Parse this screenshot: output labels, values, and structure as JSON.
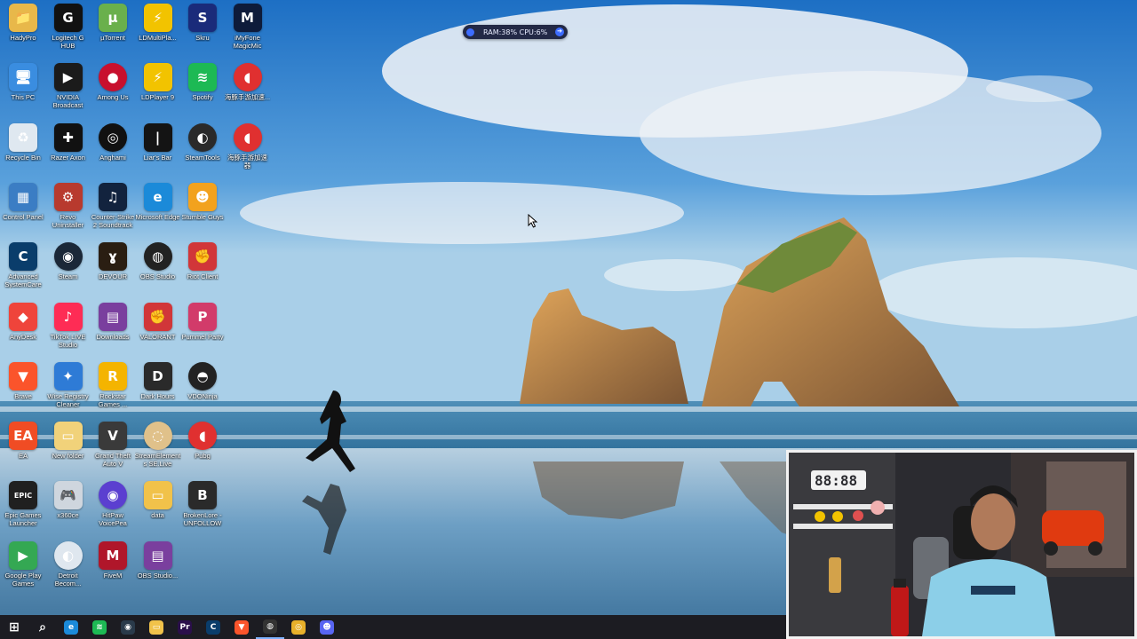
{
  "system_monitor": {
    "text": "RAM:38%  CPU:6%"
  },
  "desktop_icons": [
    {
      "name": "HadyPro",
      "glyph": "📁",
      "bg": "#e8b84a"
    },
    {
      "name": "Logitech G HUB",
      "glyph": "G",
      "bg": "#111111"
    },
    {
      "name": "µTorrent",
      "glyph": "µ",
      "bg": "#6ab04c"
    },
    {
      "name": "LDMultiPla...",
      "glyph": "⚡",
      "bg": "#f2c300"
    },
    {
      "name": "Skru",
      "glyph": "S",
      "bg": "#1a2b7a"
    },
    {
      "name": "iMyFone MagicMic",
      "glyph": "M",
      "bg": "#0e1b3a"
    },
    {
      "name": "This PC",
      "glyph": "🖥",
      "bg": "#3a8de0"
    },
    {
      "name": "NVIDIA Broadcast",
      "glyph": "▶",
      "bg": "#1b1b1b"
    },
    {
      "name": "Among Us",
      "glyph": "●",
      "bg": "#c8102e"
    },
    {
      "name": "LDPlayer 9",
      "glyph": "⚡",
      "bg": "#f2c300"
    },
    {
      "name": "Spotify",
      "glyph": "≋",
      "bg": "#1db954"
    },
    {
      "name": "海豚手游加速...",
      "glyph": "◖",
      "bg": "#e03030"
    },
    {
      "name": "Recycle Bin",
      "glyph": "♻",
      "bg": "#dfe8f0"
    },
    {
      "name": "Razer Axon",
      "glyph": "✚",
      "bg": "#111111"
    },
    {
      "name": "Anghami",
      "glyph": "◎",
      "bg": "#111111"
    },
    {
      "name": "Liar's Bar",
      "glyph": "|",
      "bg": "#141414"
    },
    {
      "name": "SteamTools",
      "glyph": "◐",
      "bg": "#2a2a2a"
    },
    {
      "name": "海豚手游加速器",
      "glyph": "◖",
      "bg": "#e03030"
    },
    {
      "name": "Control Panel",
      "glyph": "▦",
      "bg": "#3b7dc4"
    },
    {
      "name": "Revo Uninstaller",
      "glyph": "⚙",
      "bg": "#b83a2e"
    },
    {
      "name": "Counter-Strike 2 Soundtrack",
      "glyph": "♫",
      "bg": "#12233e"
    },
    {
      "name": "Microsoft Edge",
      "glyph": "e",
      "bg": "#1b8ad9"
    },
    {
      "name": "Stumble Guys",
      "glyph": "☻",
      "bg": "#f2a21e"
    },
    {
      "name": "Advanced SystemCare",
      "glyph": "C",
      "bg": "#0a3d6b"
    },
    {
      "name": "Steam",
      "glyph": "◉",
      "bg": "#1b2838"
    },
    {
      "name": "DEVOUR",
      "glyph": "ɣ",
      "bg": "#2a1e12"
    },
    {
      "name": "OBS Studio",
      "glyph": "◍",
      "bg": "#222222"
    },
    {
      "name": "Riot Client",
      "glyph": "✊",
      "bg": "#d13639"
    },
    {
      "name": "AnyDesk",
      "glyph": "◆",
      "bg": "#ef443b"
    },
    {
      "name": "TikTok LIVE Studio",
      "glyph": "♪",
      "bg": "#fe2c55"
    },
    {
      "name": "Downloads",
      "glyph": "▤",
      "bg": "#7a3f9e"
    },
    {
      "name": "VALORANT",
      "glyph": "✊",
      "bg": "#d13639"
    },
    {
      "name": "Pummel Party",
      "glyph": "P",
      "bg": "#d23b6a"
    },
    {
      "name": "Brave",
      "glyph": "▼",
      "bg": "#fb542b"
    },
    {
      "name": "Wise Registry Cleaner",
      "glyph": "✦",
      "bg": "#2e7bd6"
    },
    {
      "name": "Rockstar Games ...",
      "glyph": "R",
      "bg": "#f4b400"
    },
    {
      "name": "Dark Hours",
      "glyph": "D",
      "bg": "#2a2a2a"
    },
    {
      "name": "VDONinja",
      "glyph": "◓",
      "bg": "#222222"
    },
    {
      "name": "EA",
      "glyph": "EA",
      "bg": "#f04c24"
    },
    {
      "name": "New folder",
      "glyph": "▭",
      "bg": "#f1d27a"
    },
    {
      "name": "Grand Theft Auto V",
      "glyph": "V",
      "bg": "#3a3a3a"
    },
    {
      "name": "StreamElements SE.Live",
      "glyph": "◌",
      "bg": "#e0c18a"
    },
    {
      "name": "Pubg",
      "glyph": "◖",
      "bg": "#e03030"
    },
    {
      "name": "Epic Games Launcher",
      "glyph": "EPIC",
      "bg": "#202020"
    },
    {
      "name": "x360ce",
      "glyph": "🎮",
      "bg": "#cfd6de"
    },
    {
      "name": "HitPaw VoicePea",
      "glyph": "◉",
      "bg": "#5b3fd0"
    },
    {
      "name": "data",
      "glyph": "▭",
      "bg": "#f1c24a"
    },
    {
      "name": "BrokenLore - UNFOLLOW",
      "glyph": "B",
      "bg": "#2a2a2a"
    },
    {
      "name": "Google Play Games",
      "glyph": "▶",
      "bg": "#34a853"
    },
    {
      "name": "Detroit Becom...",
      "glyph": "◐",
      "bg": "#dfe7ef"
    },
    {
      "name": "FiveM",
      "glyph": "M",
      "bg": "#b0162a"
    },
    {
      "name": "OBS Studio...",
      "glyph": "▤",
      "bg": "#7a3f9e"
    }
  ],
  "taskbar": {
    "items": [
      {
        "name": "start",
        "glyph": "⊞",
        "bg": "transparent"
      },
      {
        "name": "search",
        "glyph": "⌕",
        "bg": "transparent"
      },
      {
        "name": "edge",
        "glyph": "e",
        "bg": "#1b8ad9"
      },
      {
        "name": "spotify",
        "glyph": "≋",
        "bg": "#1db954"
      },
      {
        "name": "steam",
        "glyph": "◉",
        "bg": "#2a3a4a"
      },
      {
        "name": "file-explorer",
        "glyph": "▭",
        "bg": "#f1c24a"
      },
      {
        "name": "premiere",
        "glyph": "Pr",
        "bg": "#2a0f4a"
      },
      {
        "name": "advanced-systemcare",
        "glyph": "C",
        "bg": "#0a3d6b"
      },
      {
        "name": "brave",
        "glyph": "▼",
        "bg": "#fb542b"
      },
      {
        "name": "obs",
        "glyph": "◍",
        "bg": "#333333"
      },
      {
        "name": "chrome",
        "glyph": "◎",
        "bg": "#e8b02a"
      },
      {
        "name": "discord",
        "glyph": "☻",
        "bg": "#5865f2"
      }
    ]
  }
}
